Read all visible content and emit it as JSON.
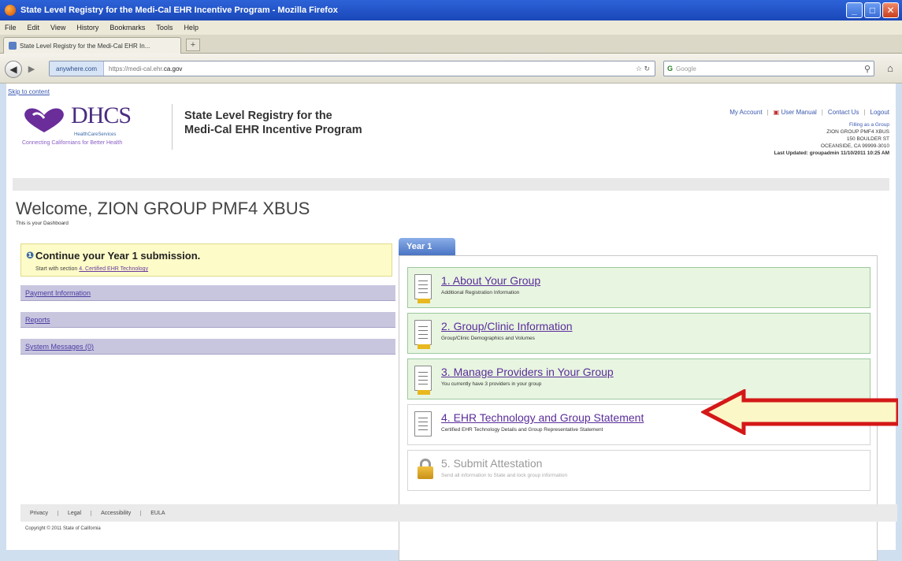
{
  "window": {
    "title": "State Level Registry for the Medi-Cal EHR Incentive Program - Mozilla Firefox",
    "controls": [
      "_",
      "□",
      "✕"
    ]
  },
  "menu": [
    "File",
    "Edit",
    "View",
    "History",
    "Bookmarks",
    "Tools",
    "Help"
  ],
  "tab": {
    "label": "State Level Registry for the Medi-Cal EHR In...",
    "new_tab": "+"
  },
  "nav": {
    "identity": "anywhere.com",
    "url_prefix": "https://medi-cal.ehr.",
    "url_main": "ca.gov",
    "url_controls": "☆ ↻",
    "search_engine": "G",
    "search_placeholder": "Google"
  },
  "page": {
    "skip_link": "Skip to content",
    "logo": {
      "name": "DHCS",
      "subtitle": "HealthCareServices",
      "tagline": "Connecting Californians for Better Health"
    },
    "site_title_line1": "State Level Registry for the",
    "site_title_line2": "Medi-Cal EHR Incentive Program",
    "top_links": {
      "my_account": "My Account",
      "user_manual": "User Manual",
      "contact": "Contact Us",
      "logout": "Logout"
    },
    "org": {
      "role": "Filling as a Group",
      "name": "ZION GROUP PMF4 XBUS",
      "address": "150 BOULDER ST",
      "city": "OCEANSIDE, CA 99999-3010",
      "last_updated": "Last Updated: groupadmin 11/10/2011 10:25 AM"
    },
    "welcome": "Welcome, ZION GROUP PMF4 XBUS",
    "dashboard_sub": "This is your Dashboard",
    "continue": {
      "title": "Continue your Year 1 submission.",
      "sub_prefix": "Start with section",
      "sub_link": "4. Certified EHR Technology"
    },
    "left_menu": [
      "Payment Information",
      "Reports",
      "System Messages (0)"
    ],
    "year_tab": "Year 1",
    "steps": [
      {
        "title": "1. About Your Group",
        "sub": "Additional Registration Information"
      },
      {
        "title": "2. Group/Clinic Information",
        "sub": "Group/Clinic Demographics and Volumes"
      },
      {
        "title": "3. Manage Providers in Your Group",
        "sub": "You currently have 3 providers in your group"
      },
      {
        "title": "4. EHR Technology and Group Statement",
        "sub": "Certified EHR Technology Details and Group Representative Statement"
      },
      {
        "title": "5. Submit Attestation",
        "sub": "Send all information to State and lock group information"
      }
    ],
    "footer": [
      "Privacy",
      "Legal",
      "Accessibility",
      "EULA"
    ],
    "copyright": "Copyright © 2011 State of California"
  }
}
